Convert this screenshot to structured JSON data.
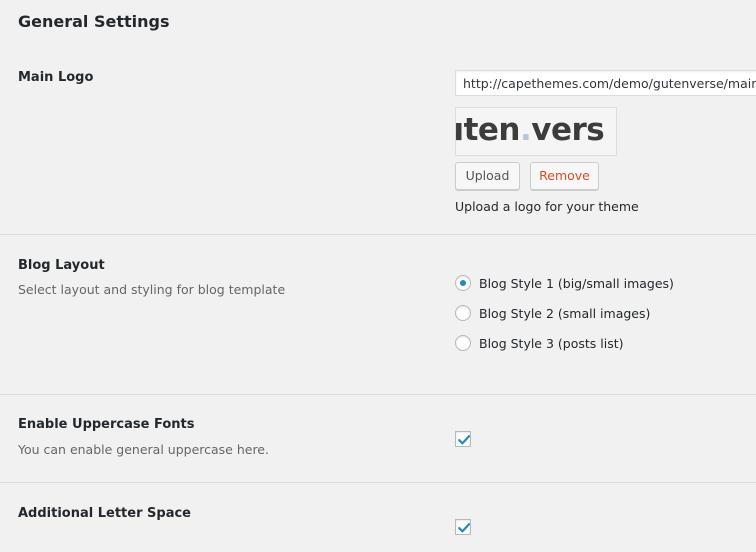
{
  "page": {
    "title": "General Settings"
  },
  "main_logo": {
    "label": "Main Logo",
    "url_value": "http://capethemes.com/demo/gutenverse/main/",
    "preview_text_before": "uten",
    "preview_text_dot": ".",
    "preview_text_after": "vers",
    "upload_label": "Upload",
    "remove_label": "Remove",
    "help": "Upload a logo for your theme"
  },
  "blog_layout": {
    "label": "Blog Layout",
    "description": "Select layout and styling for blog template",
    "options": [
      {
        "label": "Blog Style 1 (big/small images)",
        "checked": true
      },
      {
        "label": "Blog Style 2 (small images)",
        "checked": false
      },
      {
        "label": "Blog Style 3 (posts list)",
        "checked": false
      }
    ]
  },
  "uppercase_fonts": {
    "label": "Enable Uppercase Fonts",
    "description": "You can enable general uppercase here.",
    "checked": true
  },
  "letter_space": {
    "label": "Additional Letter Space",
    "checked": true
  },
  "colors": {
    "accent": "#1e8cbe",
    "remove": "#d54e21",
    "checkmark": "#1e8cbe"
  }
}
